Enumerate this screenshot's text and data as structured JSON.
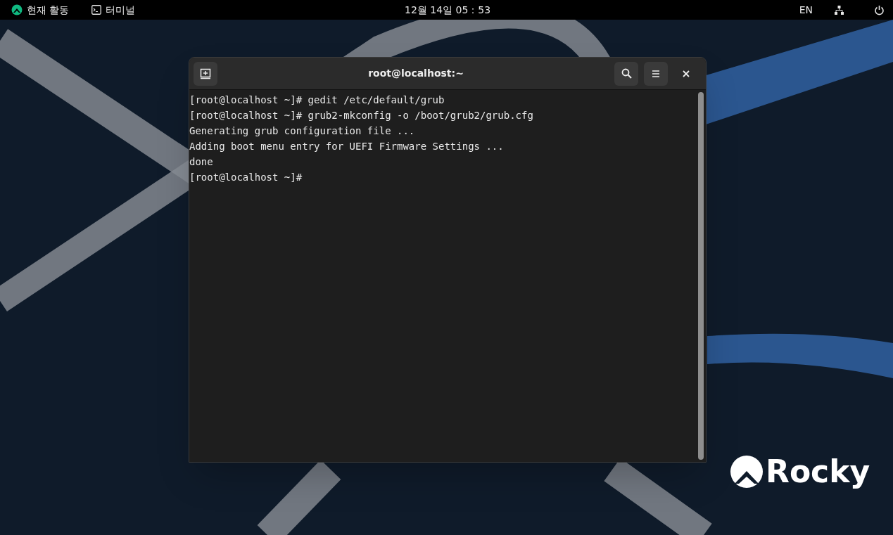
{
  "top_bar": {
    "activities": "현재 활동",
    "app_menu": "터미널",
    "clock": "12월 14일  05：53",
    "input_source": "EN"
  },
  "wallpaper": {
    "logo_text": "Rocky"
  },
  "terminal": {
    "title": "root@localhost:~",
    "lines": [
      "[root@localhost ~]# gedit /etc/default/grub",
      "[root@localhost ~]# grub2-mkconfig -o /boot/grub2/grub.cfg",
      "Generating grub configuration file ...",
      "Adding boot menu entry for UEFI Firmware Settings ...",
      "done",
      "[root@localhost ~]#"
    ]
  }
}
